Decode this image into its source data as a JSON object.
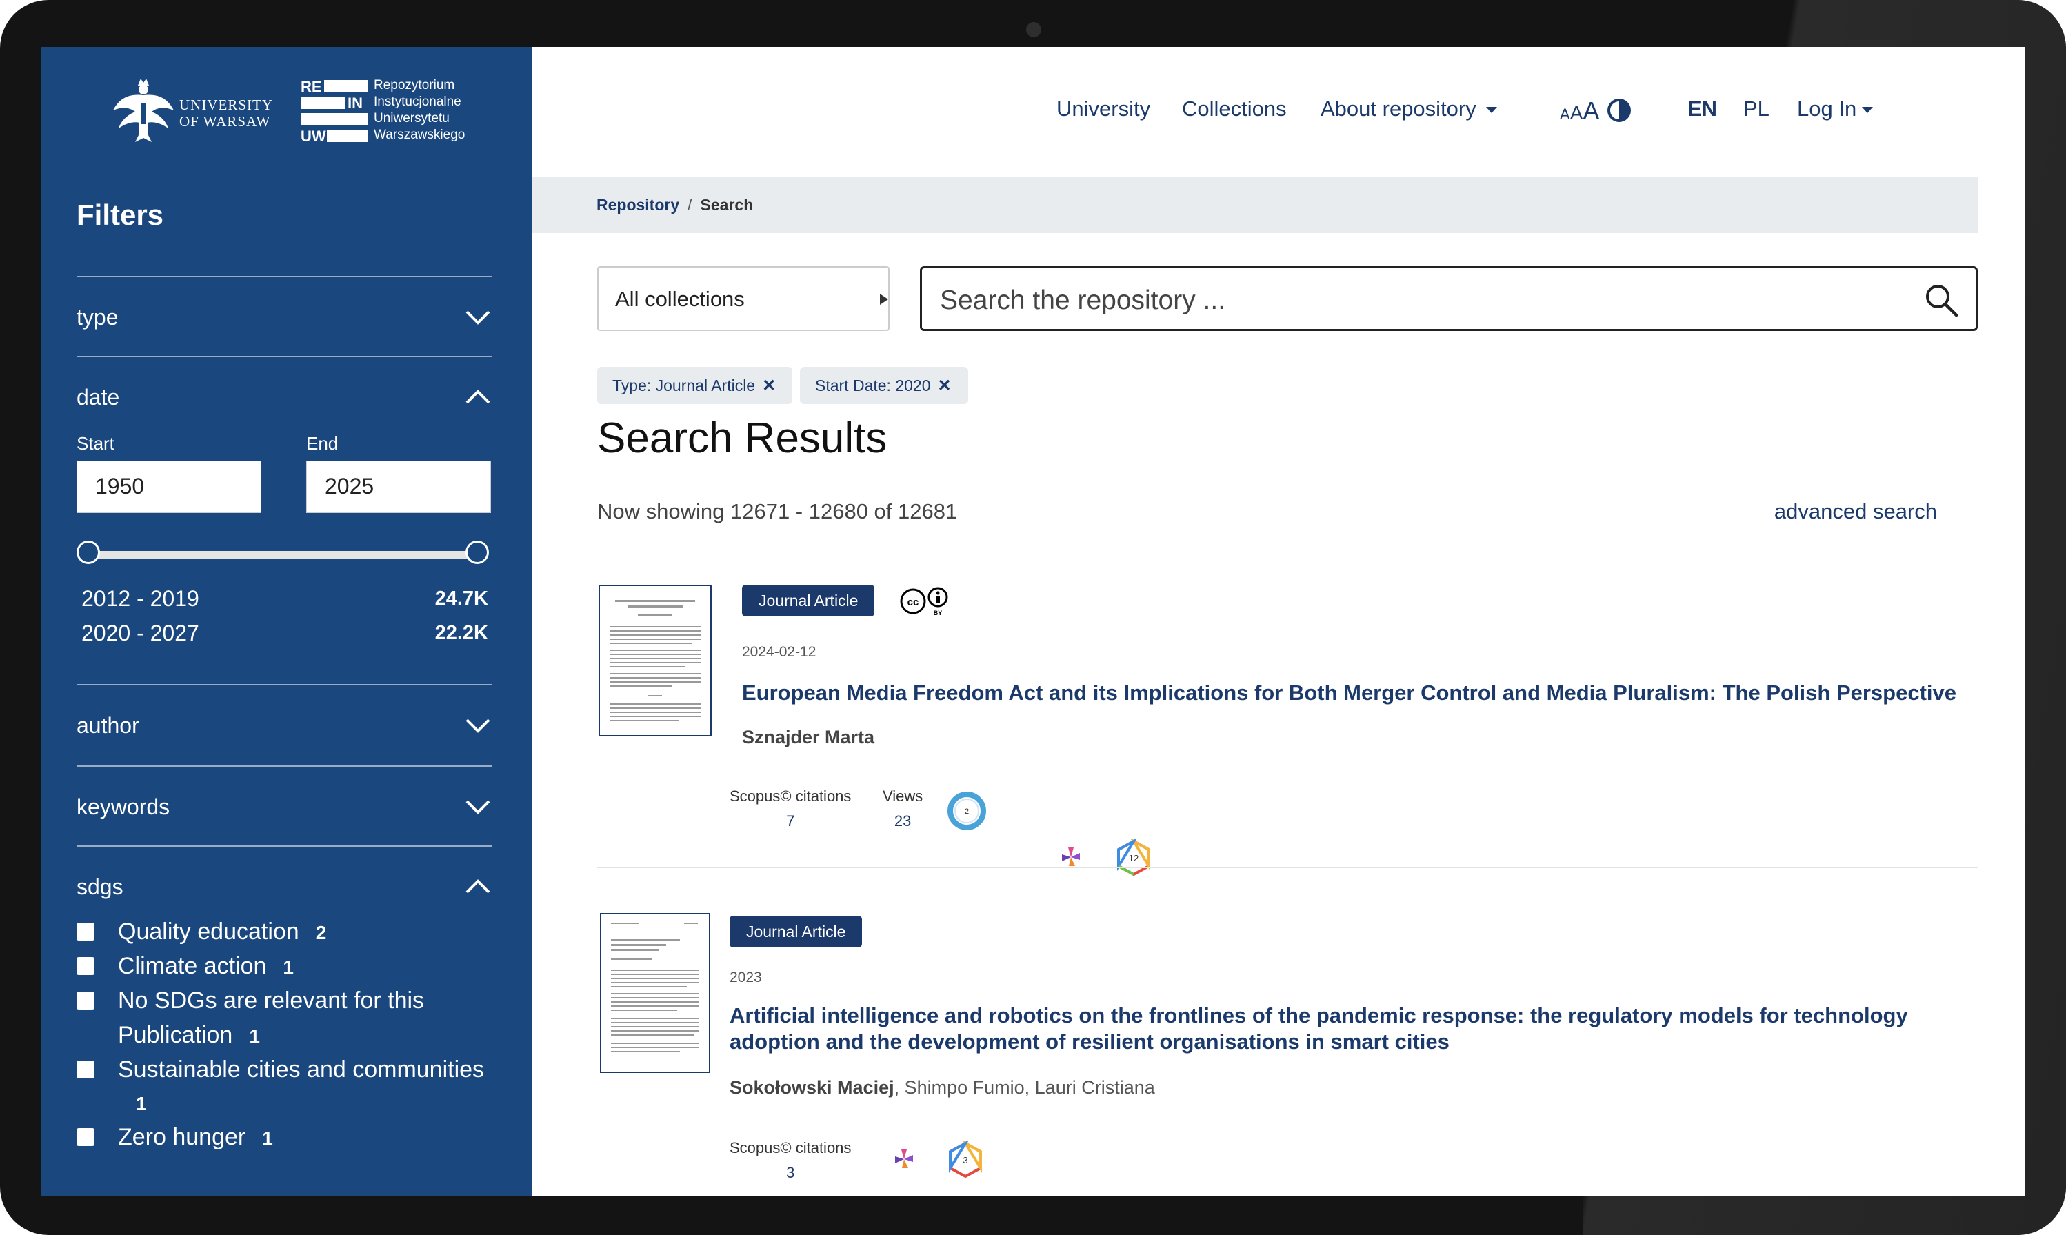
{
  "sidebar": {
    "uw_logo_text": [
      "UNIVERSITY",
      "OF WARSAW"
    ],
    "rein_logo_letters": [
      "RE",
      "IN",
      "UW"
    ],
    "rein_logo_text": [
      "Repozytorium",
      "Instytucjonalne",
      "Uniwersytetu",
      "Warszawskiego"
    ],
    "filters_title": "Filters",
    "facets": {
      "type": "type",
      "date": "date",
      "author": "author",
      "keywords": "keywords",
      "sdgs": "sdgs"
    },
    "date": {
      "start_label": "Start",
      "end_label": "End",
      "start_value": "1950",
      "end_value": "2025",
      "ranges": [
        {
          "label": "2012 - 2019",
          "count": "24.7K"
        },
        {
          "label": "2020 - 2027",
          "count": "22.2K"
        }
      ]
    },
    "sdgs": [
      {
        "label": "Quality education",
        "count": "2"
      },
      {
        "label": "Climate action",
        "count": "1"
      },
      {
        "label": "No SDGs are relevant for this Publication",
        "count": "1"
      },
      {
        "label": "Sustainable cities and communities",
        "count": "1"
      },
      {
        "label": "Zero hunger",
        "count": "1"
      }
    ]
  },
  "nav": {
    "university": "University",
    "collections": "Collections",
    "about": "About repository",
    "aaa_small": "A",
    "aaa_mid": "A",
    "aaa_big": "A",
    "lang_en": "EN",
    "lang_pl": "PL",
    "login": "Log In"
  },
  "breadcrumb": {
    "root": "Repository",
    "sep": "/",
    "current": "Search"
  },
  "search": {
    "collection_select": "All collections",
    "placeholder": "Search the repository ..."
  },
  "active_filters": [
    {
      "label": "Type: Journal Article"
    },
    {
      "label": "Start Date: 2020"
    }
  ],
  "results": {
    "title": "Search Results",
    "now_showing": "Now showing  12671 - 12680 of 12681",
    "advanced_search": "advanced search",
    "items": [
      {
        "badge": "Journal Article",
        "date": "2024-02-12",
        "title": "European Media Freedom Act and its Implications for Both Merger Control and Media Pluralism: The Polish Perspective",
        "authors_bold": "Sznajder Marta",
        "authors_rest": "",
        "scopus_label": "Scopus© citations",
        "scopus_value": "7",
        "views_label": "Views",
        "views_value": "23",
        "altmetric_value": "2",
        "dimensions_value": "12"
      },
      {
        "badge": "Journal Article",
        "date": "2023",
        "title": "Artificial intelligence and robotics on the frontlines of the pandemic response: the regulatory models for technology adoption and the development of resilient organisations in smart cities",
        "authors_bold": "Sokołowski Maciej",
        "authors_rest": ", Shimpo Fumio, Lauri Cristiana",
        "scopus_label": "Scopus© citations",
        "scopus_value": "3",
        "dimensions_value": "3"
      }
    ]
  },
  "colors": {
    "sidebar_bg": "#1b477f",
    "link": "#1b3a6b",
    "badge_bg": "#1b3a6b"
  }
}
